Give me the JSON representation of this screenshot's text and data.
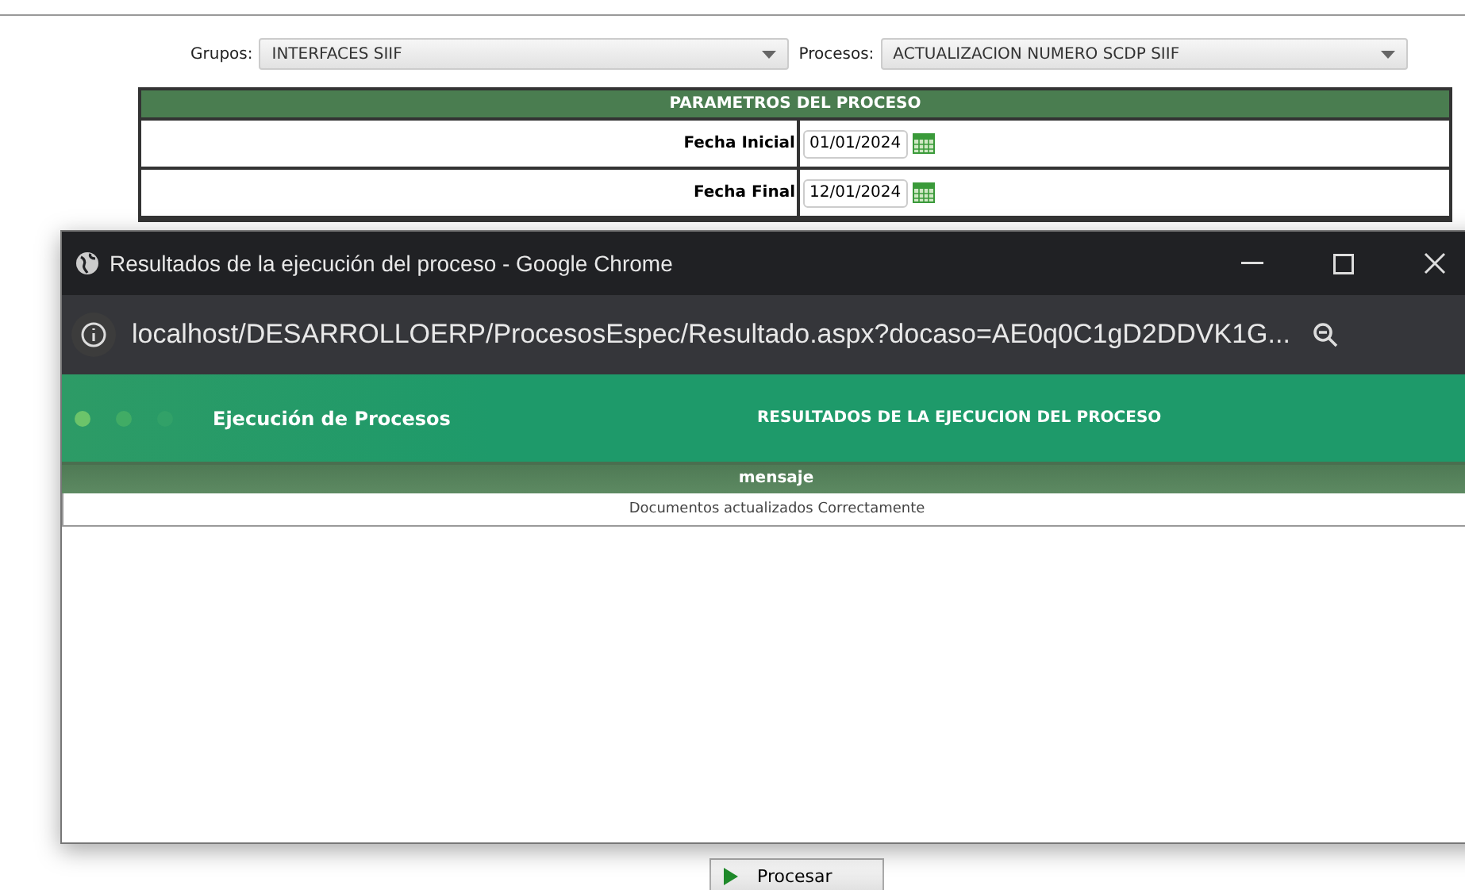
{
  "filters": [
    {
      "label": "Grupos:",
      "value": "INTERFACES SIIF"
    },
    {
      "label": "Procesos:",
      "value": "ACTUALIZACION NUMERO SCDP SIIF"
    }
  ],
  "parameters": {
    "title": "PARAMETROS DEL PROCESO",
    "rows": [
      {
        "label": "Fecha Inicial",
        "value": "01/01/2024"
      },
      {
        "label": "Fecha Final",
        "value": "12/01/2024"
      }
    ]
  },
  "popup": {
    "title": "Resultados de la ejecución del proceso - Google Chrome",
    "url": "localhost/DESARROLLOERP/ProcesosEspec/Resultado.aspx?docaso=AE0q0C1gD2DDVK1G...",
    "app_title": "Ejecución de Procesos",
    "heading": "RESULTADOS DE LA EJECUCION DEL PROCESO",
    "table": {
      "columns": [
        "mensaje"
      ],
      "rows": [
        [
          "Documentos actualizados Correctamente"
        ]
      ]
    }
  },
  "process_button": "Procesar"
}
